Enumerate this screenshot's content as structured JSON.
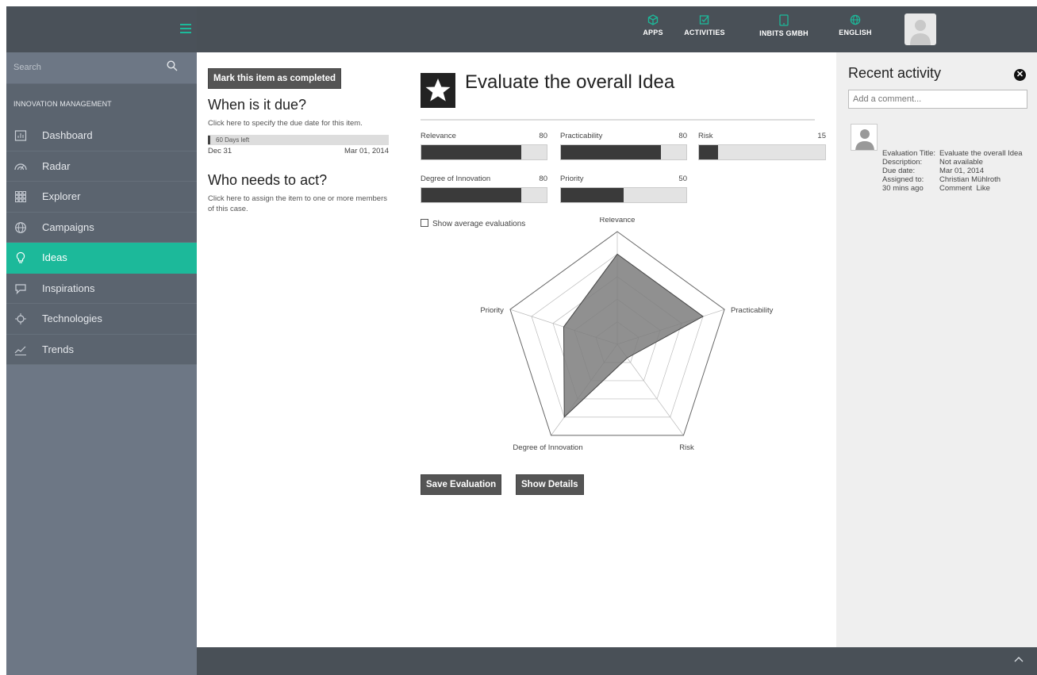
{
  "topbar": {
    "nav": [
      {
        "label": "APPS",
        "icon": "cube-icon"
      },
      {
        "label": "ACTIVITIES",
        "icon": "checkbox-icon"
      },
      {
        "label": "INBITS GMBH",
        "icon": "tablet-icon"
      },
      {
        "label": "ENGLISH",
        "icon": "globe-icon"
      }
    ],
    "accent": "#1cb99a"
  },
  "sidebar": {
    "search_placeholder": "Search",
    "section": "INNOVATION MANAGEMENT",
    "items": [
      {
        "label": "Dashboard",
        "icon": "dashboard-icon"
      },
      {
        "label": "Radar",
        "icon": "radar-icon"
      },
      {
        "label": "Explorer",
        "icon": "grid-icon"
      },
      {
        "label": "Campaigns",
        "icon": "globe-icon"
      },
      {
        "label": "Ideas",
        "icon": "lightbulb-icon",
        "active": true
      },
      {
        "label": "Inspirations",
        "icon": "speech-bubble-icon"
      },
      {
        "label": "Technologies",
        "icon": "chip-icon"
      },
      {
        "label": "Trends",
        "icon": "trend-line-icon"
      }
    ]
  },
  "task": {
    "complete_button": "Mark this item as completed",
    "due_heading": "When is it due?",
    "due_hint": "Click here to specify the due date for this item.",
    "days_left": "60 Days left",
    "start_date": "Dec 31",
    "due_date": "Mar 01, 2014",
    "act_heading": "Who needs to act?",
    "act_hint": "Click here to assign the item to one or more members of this case."
  },
  "evaluation": {
    "title": "Evaluate the overall Idea",
    "criteria": [
      {
        "name": "Relevance",
        "value": 80
      },
      {
        "name": "Practicability",
        "value": 80
      },
      {
        "name": "Risk",
        "value": 15
      },
      {
        "name": "Degree of Innovation",
        "value": 80
      },
      {
        "name": "Priority",
        "value": 50
      }
    ],
    "show_average_label": "Show average evaluations",
    "save_button": "Save Evaluation",
    "details_button": "Show Details"
  },
  "chart_data": {
    "type": "radar",
    "categories": [
      "Relevance",
      "Practicability",
      "Risk",
      "Degree of Innovation",
      "Priority"
    ],
    "values": [
      80,
      80,
      15,
      80,
      50
    ],
    "ylim": [
      0,
      100
    ]
  },
  "activity": {
    "title": "Recent activity",
    "comment_placeholder": "Add a comment...",
    "entry": {
      "rows": [
        {
          "key": "Evaluation Title:",
          "value": "Evaluate the overall Idea"
        },
        {
          "key": "Description:",
          "value": "Not available"
        },
        {
          "key": "Due date:",
          "value": "Mar 01, 2014"
        },
        {
          "key": "Assigned to:",
          "value": "Christian Mühlroth"
        }
      ],
      "time": "30 mins ago",
      "comment_link": "Comment",
      "like_link": "Like"
    }
  }
}
